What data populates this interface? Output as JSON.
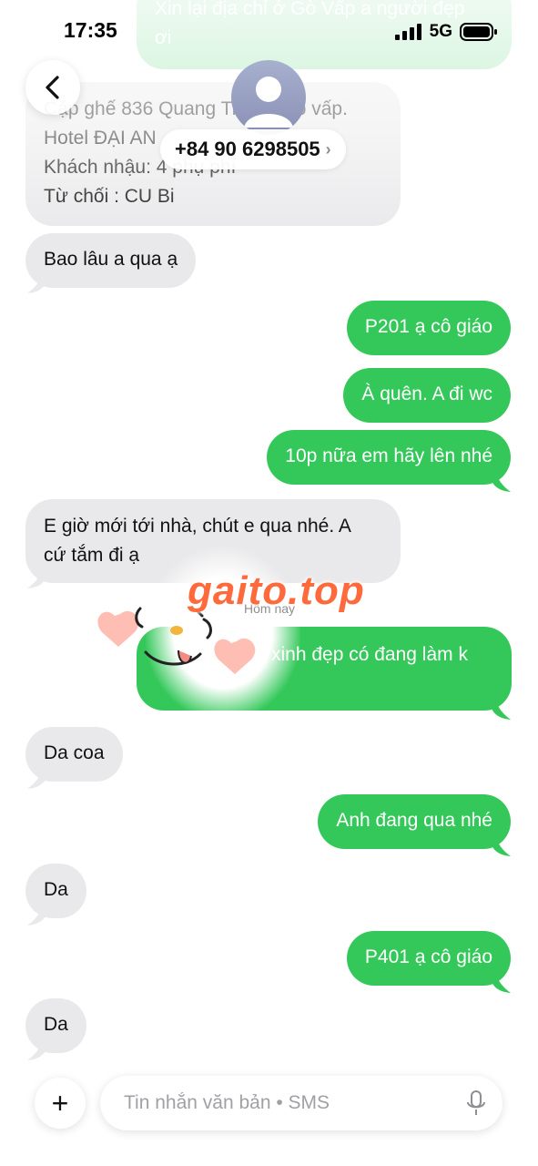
{
  "status_bar": {
    "time": "17:35",
    "network": "5G"
  },
  "header": {
    "contact": "+84 90 6298505",
    "chevron": "›"
  },
  "messages": {
    "m0": "Xin lại địa chỉ ở Gò Vấp a người đẹp",
    "m0b": "ơi",
    "m1": [
      "Cặp ghế 836 Quang Trung, Gò vấp.",
      "Hotel ĐẠI AN",
      "Khách nhậu: 4 phụ phí",
      "Từ chối : CU Bi"
    ],
    "m2": "Bao lâu a qua ạ",
    "m3": "P201 ạ cô giáo",
    "m4": "À quên. A đi wc",
    "m5": "10p nữa em hãy lên nhé",
    "m6": [
      "E giờ mới tới nhà, chút e qua nhé. A",
      "cứ tắm đi ạ"
    ],
    "m7": "xinh đẹp có đang làm k",
    "m8": "Da coa",
    "m9": "Anh đang qua nhé",
    "m10": "Da",
    "m11": "P401 ạ cô giáo",
    "m12": "Da"
  },
  "day_label": "Hôm nay",
  "watermark": "gaito.top",
  "composer": {
    "placeholder": "Tin nhắn văn bản • SMS",
    "plus": "+"
  },
  "colors": {
    "outgoing": "#34c85a",
    "incoming": "#e9e9eb",
    "watermark": "#ff6a3d"
  }
}
